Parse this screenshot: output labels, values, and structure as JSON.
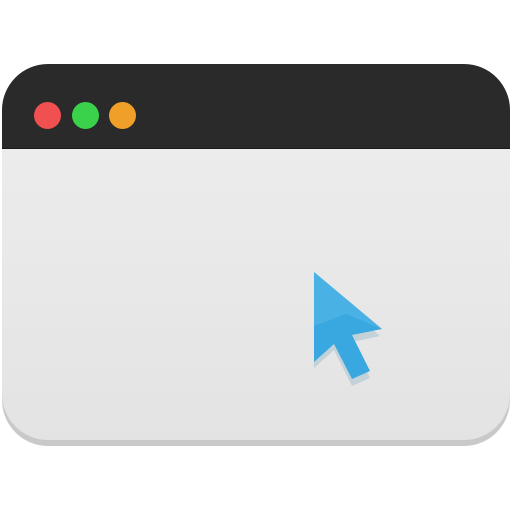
{
  "window": {
    "titlebar_color": "#2a2a2a",
    "body_color": "#e9e9e9",
    "traffic_lights": [
      {
        "name": "close",
        "color": "#f05050"
      },
      {
        "name": "minimize",
        "color": "#3ad24a"
      },
      {
        "name": "maximize",
        "color": "#f0a028"
      }
    ]
  },
  "cursor": {
    "icon": "arrow-pointer-icon",
    "color": "#3aa8e0"
  }
}
